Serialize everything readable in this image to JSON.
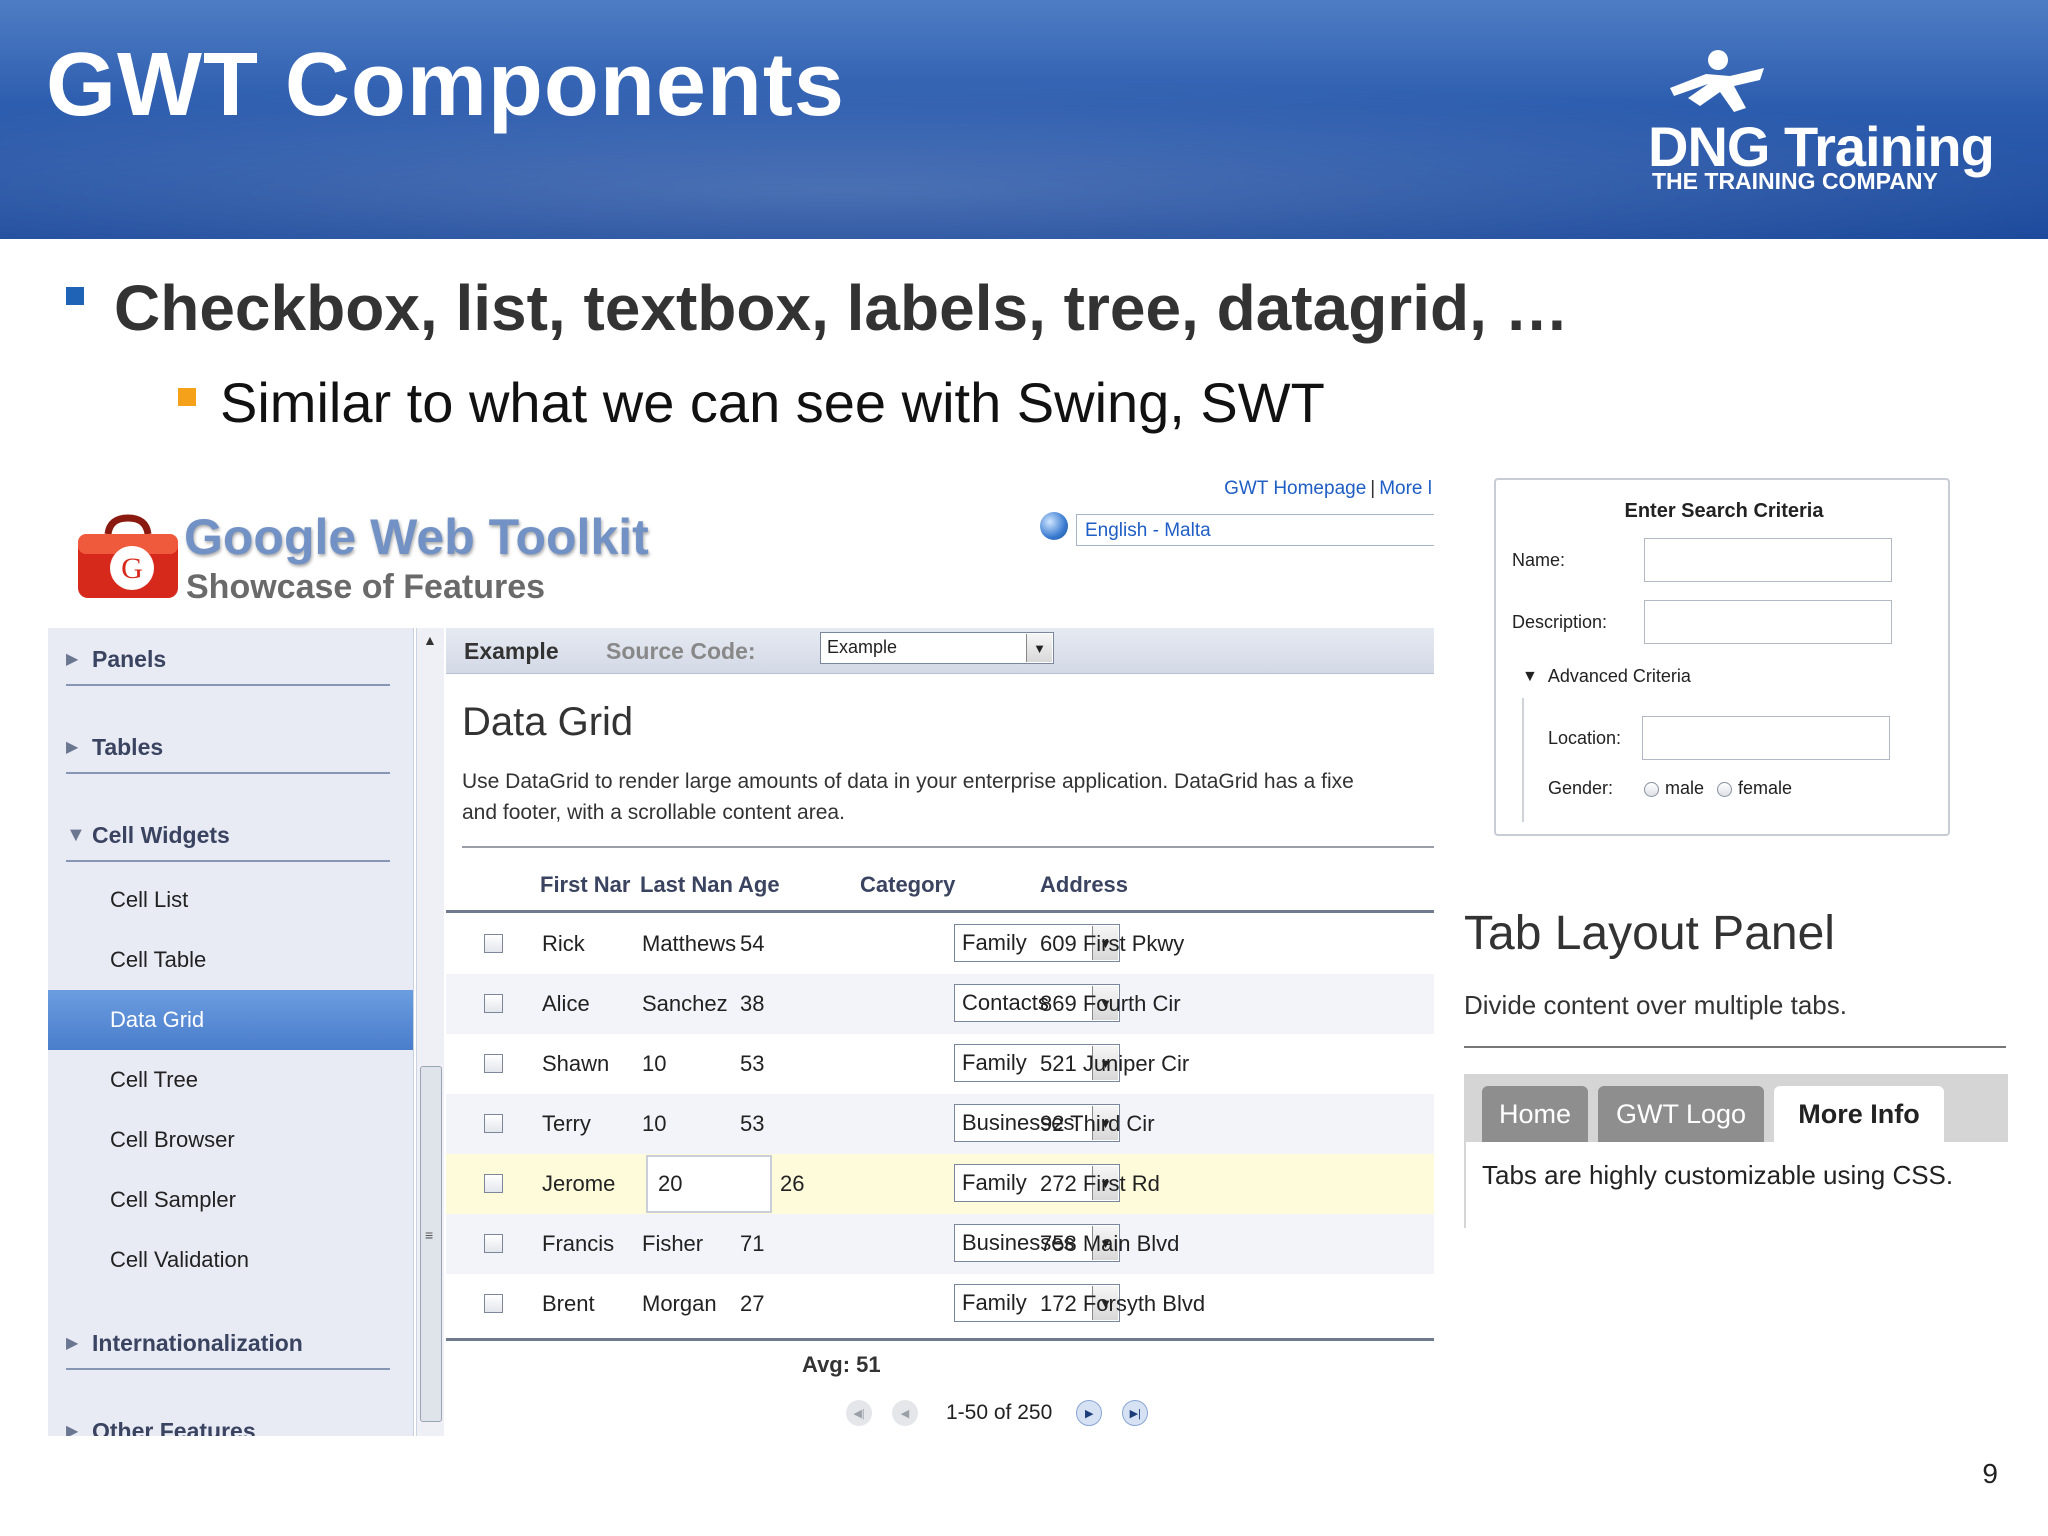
{
  "slide": {
    "title": "GWT Components",
    "page_number": "9",
    "bullet1": "Checkbox, list, textbox, labels, tree, datagrid, …",
    "bullet2": "Similar to what we can see with Swing, SWT",
    "colors": {
      "header_blue": "#2c5cae",
      "bullet_blue": "#1f63b6",
      "bullet_orange": "#f5a21a"
    }
  },
  "logo": {
    "name": "DNG Training",
    "tagline": "THE TRAINING COMPANY",
    "icon": "running-figure-icon"
  },
  "gwt": {
    "title": "Google Web Toolkit",
    "subtitle": "Showcase of Features",
    "links": {
      "homepage": "GWT Homepage",
      "separator": "|",
      "more": "More l"
    },
    "locale": "English - Malta",
    "sidebar": {
      "categories": {
        "panels": "Panels",
        "tables": "Tables",
        "cell_widgets": "Cell Widgets",
        "internationalization": "Internationalization",
        "other_features": "Other Features"
      },
      "items": [
        {
          "label": "Cell List"
        },
        {
          "label": "Cell Table"
        },
        {
          "label": "Data Grid",
          "selected": true
        },
        {
          "label": "Cell Tree"
        },
        {
          "label": "Cell Browser"
        },
        {
          "label": "Cell Sampler"
        },
        {
          "label": "Cell Validation"
        }
      ]
    },
    "tabs": {
      "example": "Example",
      "source_code": "Source Code:",
      "source_selected": "Example"
    },
    "page_title": "Data Grid",
    "description_line1": "Use DataGrid to render large amounts of data in your enterprise application. DataGrid has a fixe",
    "description_line2": "and footer, with a scrollable content area.",
    "grid": {
      "columns": [
        "First Nar",
        "Last Nan",
        "Age",
        "Category",
        "Address"
      ],
      "rows": [
        {
          "first": "Rick",
          "last": "Matthews",
          "age": "54",
          "category": "Family",
          "address": "609 First Pkwy"
        },
        {
          "first": "Alice",
          "last": "Sanchez",
          "age": "38",
          "category": "Contacts",
          "address": "869 Fourth Cir"
        },
        {
          "first": "Shawn",
          "last": "10",
          "age": "53",
          "category": "Family",
          "address": "521 Juniper Cir"
        },
        {
          "first": "Terry",
          "last": "10",
          "age": "53",
          "category": "Businesses",
          "address": "92 Third Cir"
        },
        {
          "first": "Jerome",
          "last": "20",
          "age": "26",
          "category": "Family",
          "address": "272 First Rd",
          "highlighted": true
        },
        {
          "first": "Francis",
          "last": "Fisher",
          "age": "71",
          "category": "Businesses",
          "address": "758 Main Blvd"
        },
        {
          "first": "Brent",
          "last": "Morgan",
          "age": "27",
          "category": "Family",
          "address": "172 Forsyth Blvd"
        }
      ],
      "footer": "Avg: 51",
      "pager": "1-50 of 250"
    }
  },
  "search": {
    "title": "Enter Search Criteria",
    "name_label": "Name:",
    "description_label": "Description:",
    "advanced_label": "Advanced Criteria",
    "location_label": "Location:",
    "gender_label": "Gender:",
    "gender_options": [
      "male",
      "female"
    ]
  },
  "tab_layout": {
    "title": "Tab Layout Panel",
    "description": "Divide content over multiple tabs.",
    "tabs": [
      "Home",
      "GWT Logo",
      "More Info"
    ],
    "active_tab": "More Info",
    "content": "Tabs are highly customizable using CSS."
  }
}
